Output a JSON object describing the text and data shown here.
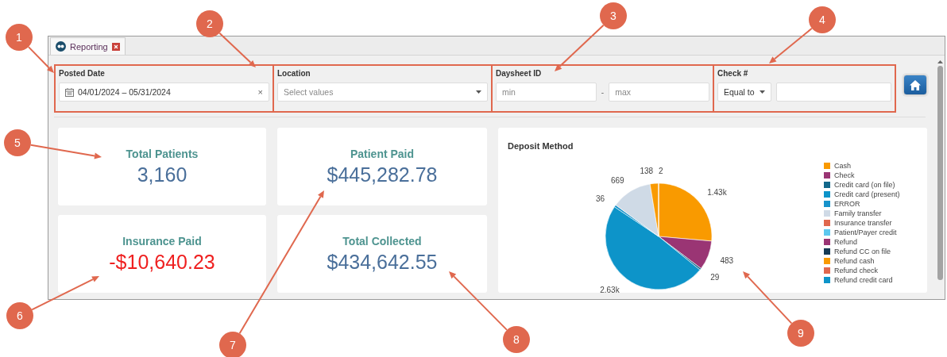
{
  "tab": {
    "title": "Reporting",
    "selected": true
  },
  "filters": [
    {
      "kind": "daterange",
      "label": "Posted Date",
      "value": "04/01/2024 – 05/31/2024",
      "clear": "×"
    },
    {
      "kind": "select",
      "label": "Location",
      "placeholder": "Select values"
    },
    {
      "kind": "range",
      "label": "Daysheet ID",
      "min_placeholder": "min",
      "separator": "-",
      "max_placeholder": "max"
    },
    {
      "kind": "compare",
      "label": "Check #",
      "operator": "Equal to"
    }
  ],
  "cards": [
    {
      "title": "Total Patients",
      "value": "3,160",
      "negative": false
    },
    {
      "title": "Patient Paid",
      "value": "$445,282.78",
      "negative": false
    },
    {
      "title": "Insurance Paid",
      "value": "-$10,640.23",
      "negative": true
    },
    {
      "title": "Total Collected",
      "value": "$434,642.55",
      "negative": false
    }
  ],
  "deposit_chart": {
    "chart_data": {
      "type": "pie",
      "title": "Deposit Method",
      "categories": [
        "Cash",
        "Check",
        "Credit card (on file)",
        "Credit card (present)",
        "ERROR",
        "Family transfer",
        "Insurance transfer",
        "Patient/Payer credit",
        "Refund",
        "Refund CC on file",
        "Refund cash",
        "Refund check",
        "Refund credit card"
      ],
      "values": [
        1430,
        483,
        29,
        2630,
        36,
        669,
        null,
        null,
        null,
        null,
        138,
        2,
        null
      ],
      "colors": [
        "#f99a00",
        "#9a3574",
        "#12688a",
        "#0d94c9",
        "#1793cb",
        "#cfdae6",
        "#e0684e",
        "#5cc8ef",
        "#9a3574",
        "#163b55",
        "#f99a00",
        "#e0684e",
        "#0d94c9"
      ],
      "value_labels": [
        "1.43k",
        "483",
        "29",
        "2.63k",
        "36",
        "669",
        null,
        null,
        null,
        null,
        "138",
        "2",
        null
      ]
    }
  },
  "callouts": [
    "1",
    "2",
    "3",
    "4",
    "5",
    "6",
    "7",
    "8",
    "9"
  ]
}
